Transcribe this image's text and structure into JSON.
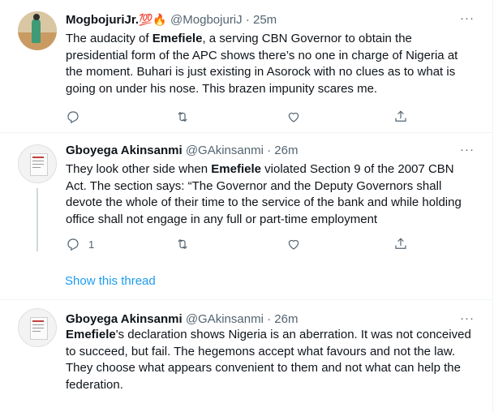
{
  "tweets": [
    {
      "name": "MogbojuriJr.",
      "badge_emoji": "💯🔥",
      "handle": "@MogbojuriJ",
      "time": "25m",
      "more": "···",
      "parts": [
        {
          "t": "The audacity of "
        },
        {
          "t": "Emefiele",
          "b": true
        },
        {
          "t": ", a serving CBN Governor to obtain the presidential form of the APC shows there’s no one in charge of Nigeria at the moment. Buhari is just existing in Asorock with no clues as to what is going on under his nose. This brazen impunity scares me."
        }
      ],
      "reply_count": "",
      "retweet_count": "",
      "like_count": ""
    },
    {
      "name": "Gboyega Akinsanmi",
      "handle": "@GAkinsanmi",
      "time": "26m",
      "more": "···",
      "parts": [
        {
          "t": "They look other side when "
        },
        {
          "t": "Emefiele",
          "b": true
        },
        {
          "t": " violated Section 9 of the 2007 CBN Act. The section says: “The Governor and the Deputy Governors shall devote the whole of their time to the service of the bank and while holding office shall not engage in any full or part-time employment"
        }
      ],
      "reply_count": "1",
      "retweet_count": "",
      "like_count": ""
    },
    {
      "name": "Gboyega Akinsanmi",
      "handle": "@GAkinsanmi",
      "time": "26m",
      "more": "···",
      "parts": [
        {
          "t": "Emefiele",
          "b": true
        },
        {
          "t": "'s declaration shows Nigeria is an aberration. It was not conceived to succeed, but fail. The hegemons accept what favours and not the law. They choose what appears convenient to them and not what can help the federation."
        }
      ]
    }
  ],
  "show_thread_label": "Show this thread",
  "colors": {
    "link": "#1d9bf0",
    "muted": "#536471",
    "text": "#0f1419",
    "divider": "#eff3f4"
  },
  "icons": {
    "reply": "reply-icon",
    "retweet": "retweet-icon",
    "like": "heart-icon",
    "share": "share-icon",
    "more": "more-icon"
  }
}
